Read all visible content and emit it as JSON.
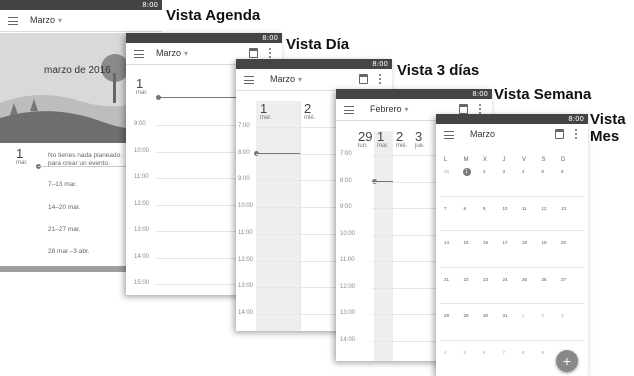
{
  "status": {
    "time": "8:00",
    "icons": "signal-battery"
  },
  "views": {
    "agenda": {
      "title": "Vista Agenda",
      "month": "Marzo",
      "banner_text": "marzo de 2016",
      "first_day_num": "1",
      "first_day_name": "mar.",
      "empty_msg_line1": "No tienes nada planeado.",
      "empty_msg_line2": "para crear un evento.",
      "weeks": [
        "7–13 mar.",
        "14–20 mar.",
        "21–27 mar.",
        "28 mar.–3 abr."
      ]
    },
    "day": {
      "title": "Vista Día",
      "month": "Marzo",
      "day_num": "1",
      "day_name": "mar.",
      "hours": [
        "9:00",
        "10:00",
        "11:00",
        "12:00",
        "13:00",
        "14:00",
        "15:00"
      ]
    },
    "three_day": {
      "title": "Vista 3 días",
      "month": "Marzo",
      "days": [
        {
          "num": "1",
          "name": "mar."
        },
        {
          "num": "2",
          "name": "mié."
        }
      ],
      "hours": [
        "7:00",
        "8:00",
        "9:00",
        "10:00",
        "11:00",
        "12:00",
        "13:00",
        "14:00"
      ]
    },
    "week": {
      "title": "Vista Semana",
      "month": "Febrero",
      "days": [
        {
          "num": "29",
          "name": "lun."
        },
        {
          "num": "1",
          "name": "mar."
        },
        {
          "num": "2",
          "name": "mié."
        },
        {
          "num": "3",
          "name": "jue."
        }
      ],
      "hours": [
        "7:00",
        "8:00",
        "9:00",
        "10:00",
        "11:00",
        "12:00",
        "13:00",
        "14:00"
      ]
    },
    "month": {
      "title_line1": "Vista",
      "title_line2": "Mes",
      "month": "Marzo",
      "weekdays": [
        "L",
        "M",
        "X",
        "J",
        "V",
        "S",
        "D"
      ],
      "rows": [
        [
          "29",
          "1",
          "2",
          "3",
          "4",
          "5",
          "6"
        ],
        [
          "7",
          "8",
          "9",
          "10",
          "11",
          "12",
          "13"
        ],
        [
          "14",
          "15",
          "16",
          "17",
          "18",
          "19",
          "20"
        ],
        [
          "21",
          "22",
          "23",
          "24",
          "25",
          "26",
          "27"
        ],
        [
          "28",
          "29",
          "30",
          "31",
          "1",
          "2",
          "3"
        ],
        [
          "4",
          "5",
          "6",
          "7",
          "8",
          "9",
          ""
        ]
      ],
      "fab_label": "+"
    }
  }
}
